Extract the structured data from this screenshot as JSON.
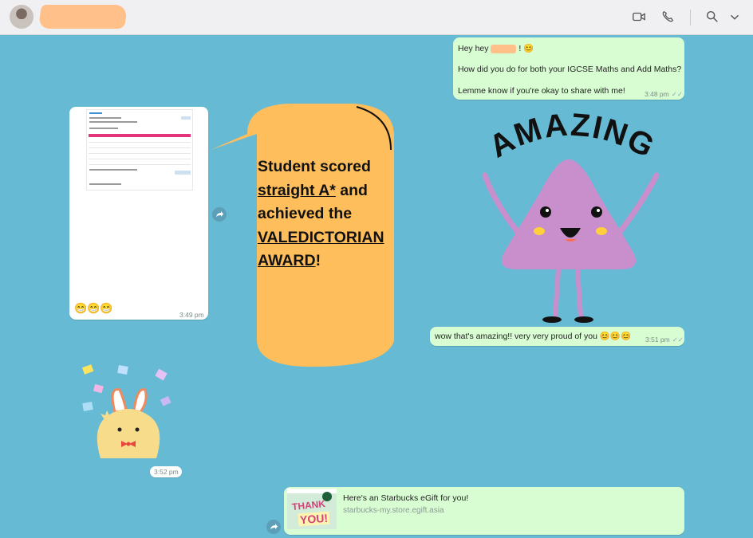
{
  "header": {
    "icons": [
      "video-call-icon",
      "voice-call-icon",
      "search-icon",
      "chevron-down-icon"
    ]
  },
  "messages": {
    "m1": {
      "line1_a": "Hey hey",
      "line1_b": "! 😊",
      "line2": "How did you do for both your IGCSE Maths and Add Maths?",
      "line3": "Lemme know if you're okay to share with me!",
      "time": "3:48 pm"
    },
    "m2": {
      "emojis": "😁😁😁",
      "time": "3:49 pm"
    },
    "m3": {
      "text": "wow that's amazing!! very very proud of you 😊😊😊",
      "time": "3:51 pm"
    },
    "m4": {
      "time": "3:52 pm"
    },
    "m5": {
      "text": "Here's an Starbucks eGift for you!",
      "link": "starbucks-my.store.egift.asia"
    }
  },
  "overlay": {
    "l1": "Student scored",
    "l2a": "straight A*",
    "l2b": " and",
    "l3": "achieved the",
    "l4": "VALEDICTORIAN",
    "l5a": "AWARD",
    "l5b": "!"
  },
  "sticker": {
    "word": "AMAZING"
  },
  "giftcard": {
    "l1": "THANK",
    "l2": "YOU!"
  },
  "colors": {
    "chat_bg": "#66bad3",
    "outgoing": "#d9fdd3",
    "incoming": "#ffffff",
    "speech": "#ffbe5c",
    "sticker_body": "#c98fcd"
  }
}
